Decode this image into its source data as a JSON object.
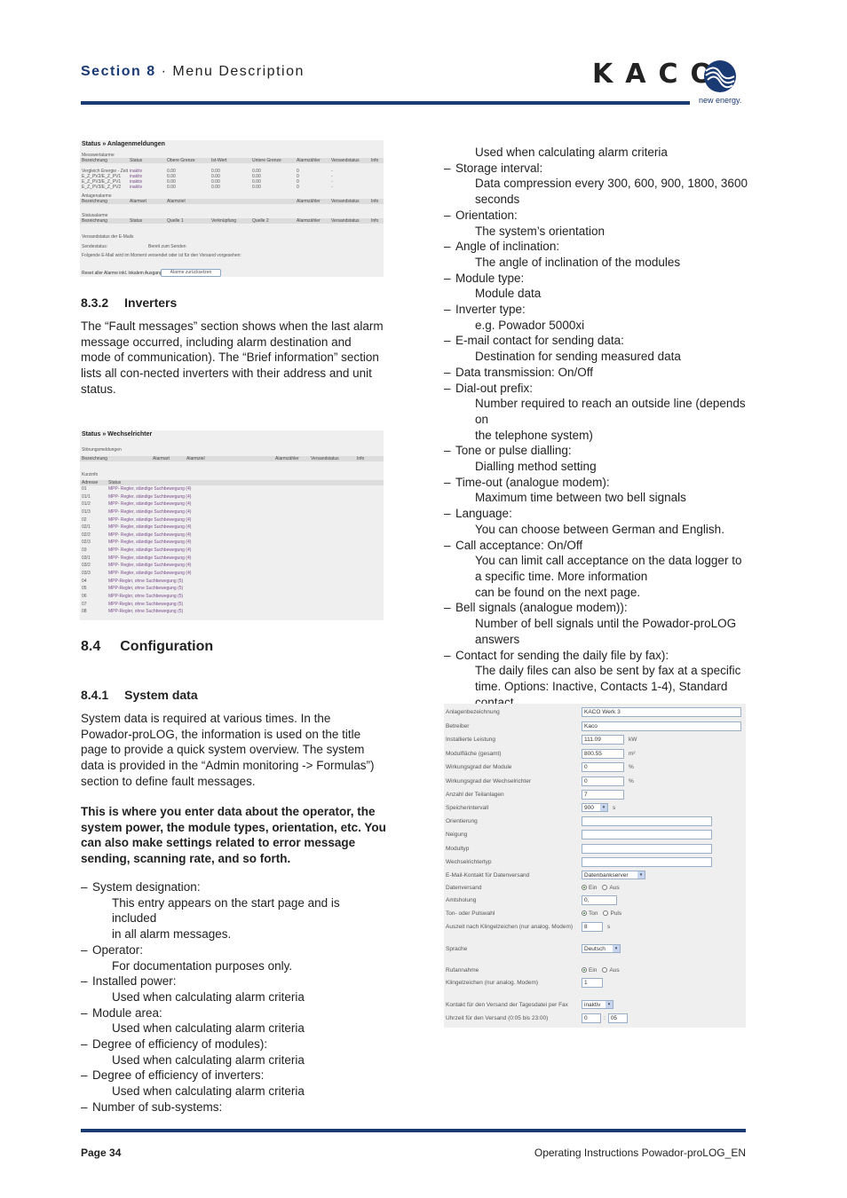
{
  "header": {
    "section_number": "Section 8",
    "separator": " · ",
    "section_title": "Menu Description",
    "logo_text": "KACO",
    "tagline": "new energy."
  },
  "shot_alarms": {
    "title": "Status » Anlagenmeldungen",
    "measure_section": "Messwertalarme",
    "measure_headers": [
      "Bezeichnung",
      "Status",
      "Obere Grenze",
      "Ist-Wert",
      "Untere Grenze",
      "Alarmzähler",
      "Versandstatus",
      "Info"
    ],
    "measure_rows": [
      [
        "Vergleich Energie - Zeit",
        "inaktiv",
        "0.00",
        "0.00",
        "0.00",
        "0",
        "-",
        ""
      ],
      [
        "E_Z_PV2/E_Z_PV1",
        "inaktiv",
        "0.00",
        "0.00",
        "0.00",
        "0",
        "-",
        ""
      ],
      [
        "E_Z_PV3/E_Z_PV1",
        "inaktiv",
        "0.00",
        "0.00",
        "0.00",
        "0",
        "-",
        ""
      ],
      [
        "E_Z_PV3/E_Z_PV2",
        "inaktiv",
        "0.00",
        "0.00",
        "0.00",
        "0",
        "-",
        ""
      ]
    ],
    "system_section": "Anlagenalarme",
    "system_headers": [
      "Bezeichnung",
      "Alarmart",
      "Alarmziel",
      "Alarmzähler",
      "Versandstatus",
      "Info"
    ],
    "status_section": "Statusalarme",
    "status_headers": [
      "Bezeichnung",
      "Status",
      "Quelle 1",
      "Verknüpfung",
      "Quelle 2",
      "Alarmzähler",
      "Versandstatus",
      "Info"
    ],
    "email_section": "Versandstatus der E-Mails",
    "send_status_label": "Sendestatus:",
    "send_status_value": "Bereit zum Senden",
    "email_note": "Folgende E-Mail wird im Moment versendet oder ist für den Versand vorgesehen:",
    "reset_label": "Reset aller Alarme inkl. lokalem Ausgang",
    "reset_button": "Alarme zurücksetzen"
  },
  "inverters": {
    "heading_num": "8.3.2",
    "heading": "Inverters",
    "text": "The “Fault messages” section shows when the last alarm message occurred, including alarm destination and mode of communication). The “Brief information” section lists all con-nected inverters with their address and unit status."
  },
  "shot_inverters": {
    "title": "Status » Wechselrichter",
    "fault_section": "Störungsmeldungen",
    "fault_headers": [
      "Bezeichnung",
      "Alarmart",
      "Alarmziel",
      "Alarmzähler",
      "Versandstatus",
      "Info"
    ],
    "brief_section": "Kurzinfo",
    "brief_headers": [
      "Adresse",
      "Status"
    ],
    "rows": [
      [
        "01",
        "MPP- Regler, ständige Suchbewegung (4)"
      ],
      [
        "01/1",
        "MPP- Regler, ständige Suchbewegung (4)"
      ],
      [
        "01/2",
        "MPP- Regler, ständige Suchbewegung (4)"
      ],
      [
        "01/3",
        "MPP- Regler, ständige Suchbewegung (4)"
      ],
      [
        "02",
        "MPP- Regler, ständige Suchbewegung (4)"
      ],
      [
        "02/1",
        "MPP- Regler, ständige Suchbewegung (4)"
      ],
      [
        "02/2",
        "MPP- Regler, ständige Suchbewegung (4)"
      ],
      [
        "02/3",
        "MPP- Regler, ständige Suchbewegung (4)"
      ],
      [
        "03",
        "MPP- Regler, ständige Suchbewegung (4)"
      ],
      [
        "03/1",
        "MPP- Regler, ständige Suchbewegung (4)"
      ],
      [
        "03/2",
        "MPP- Regler, ständige Suchbewegung (4)"
      ],
      [
        "03/3",
        "MPP- Regler, ständige Suchbewegung (4)"
      ],
      [
        "04",
        "MPP-Regler, ohne Suchbewegung (5)"
      ],
      [
        "05",
        "MPP-Regler, ohne Suchbewegung (5)"
      ],
      [
        "06",
        "MPP-Regler, ohne Suchbewegung (5)"
      ],
      [
        "07",
        "MPP-Regler, ohne Suchbewegung (5)"
      ],
      [
        "08",
        "MPP-Regler, ohne Suchbewegung (5)"
      ]
    ]
  },
  "configuration": {
    "heading_num": "8.4",
    "heading": "Configuration",
    "sub_num": "8.4.1",
    "sub_heading": "System data",
    "intro": "System data is required at various times. In the Powador-proLOG, the information is used on the title page to provide a quick system overview. The system data is provided in the “Admin monitoring -> Formulas”) section to define fault messages.",
    "bold_intro": "This is where you enter data about the operator, the system power, the module types, orientation, etc. You can also make settings related to error message sending, scanning rate, and so forth."
  },
  "list_left": [
    {
      "label": "System designation:",
      "desc": [
        "This entry appears on the start page and is included",
        " in all alarm messages."
      ]
    },
    {
      "label": "Operator:",
      "desc": [
        "For documentation purposes only."
      ]
    },
    {
      "label": "Installed power:",
      "desc": [
        "Used when calculating alarm criteria"
      ]
    },
    {
      "label": "Module area:",
      "desc": [
        "Used when calculating alarm criteria"
      ]
    },
    {
      "label": "Degree of efficiency of modules):",
      "desc": [
        "Used when calculating alarm criteria"
      ]
    },
    {
      "label": "Degree of efficiency of inverters:",
      "desc": [
        "Used when calculating alarm criteria"
      ]
    },
    {
      "label": "Number of sub-systems:",
      "desc": []
    }
  ],
  "list_right_continuation": "Used when calculating alarm criteria",
  "list_right": [
    {
      "label": "Storage interval:",
      "desc": [
        "Data compression every 300, 600, 900, 1800, 3600",
        "seconds"
      ]
    },
    {
      "label": "Orientation:",
      "desc": [
        "The system’s orientation"
      ]
    },
    {
      "label": "Angle of inclination:",
      "desc": [
        "The angle of inclination of the modules"
      ]
    },
    {
      "label": "Module type:",
      "desc": [
        "Module data"
      ]
    },
    {
      "label": "Inverter type:",
      "desc": [
        "e.g. Powador 5000xi"
      ]
    },
    {
      "label": "E-mail contact for sending data:",
      "desc": [
        "Destination for sending measured data"
      ]
    },
    {
      "label": "Data transmission: On/Off",
      "desc": []
    },
    {
      "label": "Dial-out prefix:",
      "desc": [
        "Number required to reach an outside line (depends on",
        "the telephone system)"
      ]
    },
    {
      "label": "Tone or pulse dialling:",
      "desc": [
        "Dialling method setting"
      ]
    },
    {
      "label": "Time-out (analogue modem):",
      "desc": [
        "Maximum time between two bell signals"
      ]
    },
    {
      "label": "Language:",
      "desc": [
        "You can choose between German and English."
      ]
    },
    {
      "label": "Call acceptance: On/Off",
      "desc": [
        "You can limit call acceptance on the data logger to",
        "a specific time. More information",
        "can be found on the next page."
      ]
    },
    {
      "label": "Bell signals (analogue modem)):",
      "desc": [
        "Number of bell signals until the Powador-proLOG",
        "answers"
      ]
    },
    {
      "label": "Contact for sending the daily file by fax):",
      "desc": [
        "The daily files can also be sent by fax at a specific",
        "time. Options: Inactive, Contacts 1-4), Standard",
        "contact."
      ]
    }
  ],
  "form": {
    "anlagenbezeichnung": {
      "label": "Anlagenbezeichnung",
      "value": "KACO Werk 3"
    },
    "betreiber": {
      "label": "Betreiber",
      "value": "Kaco"
    },
    "leistung": {
      "label": "Installierte Leistung",
      "value": "111.09",
      "unit": "kW"
    },
    "modulflaeche": {
      "label": "Modulfläche (gesamt)",
      "value": "800.55",
      "unit": "m²"
    },
    "wg_module": {
      "label": "Wirkungsgrad der Module",
      "value": "0",
      "unit": "%"
    },
    "wg_wr": {
      "label": "Wirkungsgrad der Wechselrichter",
      "value": "0",
      "unit": "%"
    },
    "teilanlagen": {
      "label": "Anzahl der Teilanlagen",
      "value": "7"
    },
    "speicherintervall": {
      "label": "Speicherintervall",
      "value": "900",
      "unit": "s"
    },
    "orientierung": {
      "label": "Orientierung",
      "value": ""
    },
    "neigung": {
      "label": "Neigung",
      "value": ""
    },
    "modultyp": {
      "label": "Modultyp",
      "value": ""
    },
    "wr_typ": {
      "label": "Wechselrichtertyp",
      "value": ""
    },
    "email_kontakt": {
      "label": "E-Mail-Kontakt für Datenversand",
      "value": "Datenbankserver"
    },
    "datenversand": {
      "label": "Datenversand",
      "on": "Ein",
      "off": "Aus",
      "selected": "Ein"
    },
    "amtsholung": {
      "label": "Amtsholung",
      "value": "0,"
    },
    "wahl": {
      "label": "Ton- oder Pulswahl",
      "on": "Ton",
      "off": "Puls",
      "selected": "Ton"
    },
    "auszeit": {
      "label": "Auszeit nach Klingelzeichen (nur analog. Modem)",
      "value": "8",
      "unit": "s"
    },
    "sprache": {
      "label": "Sprache",
      "value": "Deutsch"
    },
    "rufannahme": {
      "label": "Rufannahme",
      "on": "Ein",
      "off": "Aus",
      "selected": "Ein"
    },
    "klingelzeichen": {
      "label": "Klingelzeichen (nur analog. Modem)",
      "value": "1"
    },
    "fax_kontakt": {
      "label": "Kontakt für den Versand der Tagesdatei per Fax",
      "value": "inaktiv"
    },
    "uhrzeit": {
      "label": "Uhrzeit für den Versand (0:05 bis 23:00)",
      "hour": "0",
      "sep": ":",
      "minute": "05"
    }
  },
  "footer": {
    "page": "Page 34",
    "doc_title": "Operating Instructions Powador-proLOG_EN"
  }
}
